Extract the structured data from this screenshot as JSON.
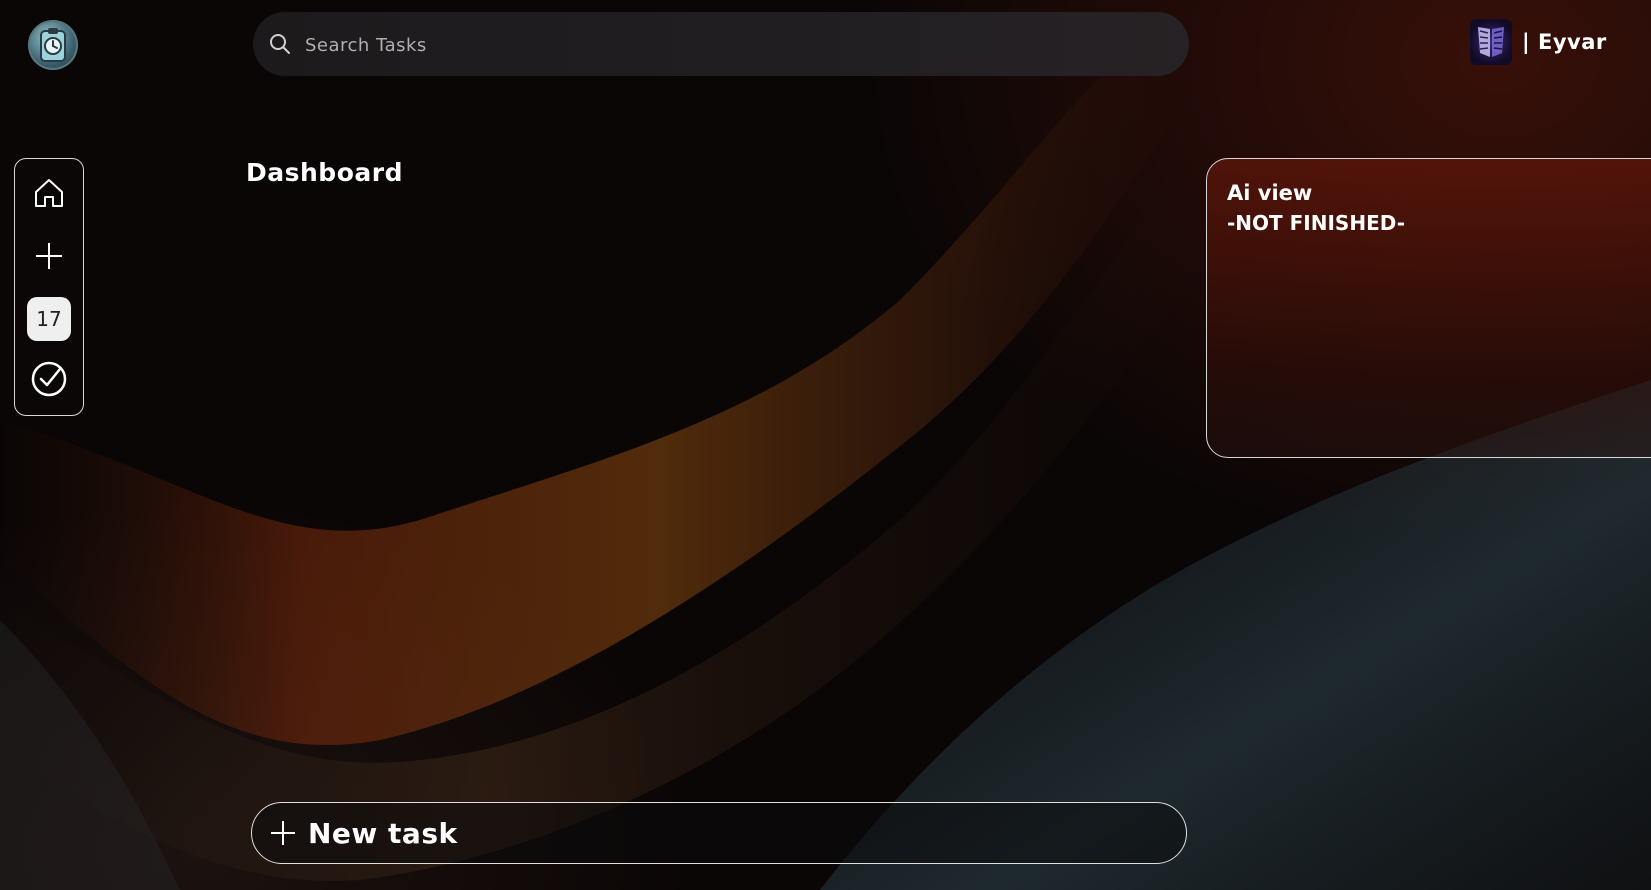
{
  "header": {
    "search": {
      "placeholder": "Search Tasks",
      "value": ""
    },
    "user": {
      "name": "| Eyvar"
    }
  },
  "sidebar": {
    "items": [
      {
        "name": "home",
        "icon": "home-icon"
      },
      {
        "name": "add",
        "icon": "plus-icon"
      },
      {
        "name": "calendar",
        "icon": "calendar-icon",
        "label": "17"
      },
      {
        "name": "completed",
        "icon": "check-circle-icon"
      }
    ]
  },
  "main": {
    "title": "Dashboard",
    "new_task_label": "New task"
  },
  "ai_panel": {
    "title": "Ai view",
    "status": "-NOT FINISHED-"
  },
  "colors": {
    "background": "#0b0606",
    "accent_orange": "#8a3a12",
    "panel_red": "#5f160a",
    "border": "#d8d8d8"
  }
}
